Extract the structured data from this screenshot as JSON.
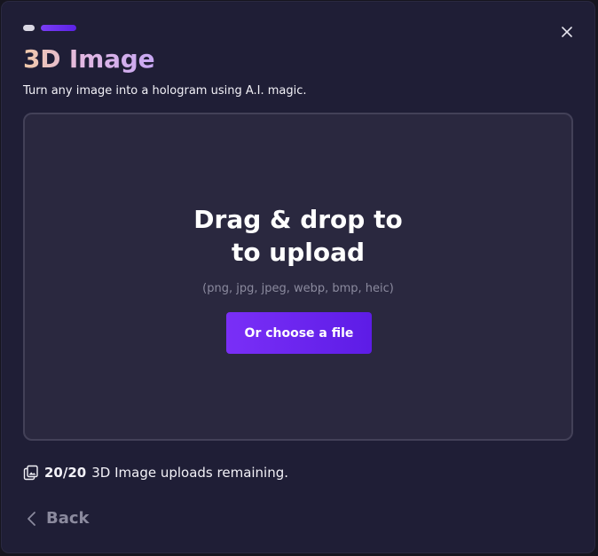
{
  "modal": {
    "title": "3D Image",
    "subtitle": "Turn any image into a hologram using A.I. magic."
  },
  "stepper": {
    "total_steps": 2,
    "current_step": 2
  },
  "dropzone": {
    "title_line1": "Drag & drop to",
    "title_line2": "to upload",
    "formats": "(png, jpg, jpeg, webp, bmp, heic)",
    "choose_label": "Or choose a file"
  },
  "quota": {
    "count": "20/20",
    "text": "3D Image uploads remaining."
  },
  "footer": {
    "back_label": "Back"
  },
  "icons": {
    "close": "close-icon",
    "uploads": "image-stack-icon",
    "back": "chevron-left-icon"
  },
  "colors": {
    "modal_bg": "#1f1e36",
    "dropzone_bg": "#2a283f",
    "accent": "#6f2cf5",
    "muted_text": "#8b8a9e"
  }
}
